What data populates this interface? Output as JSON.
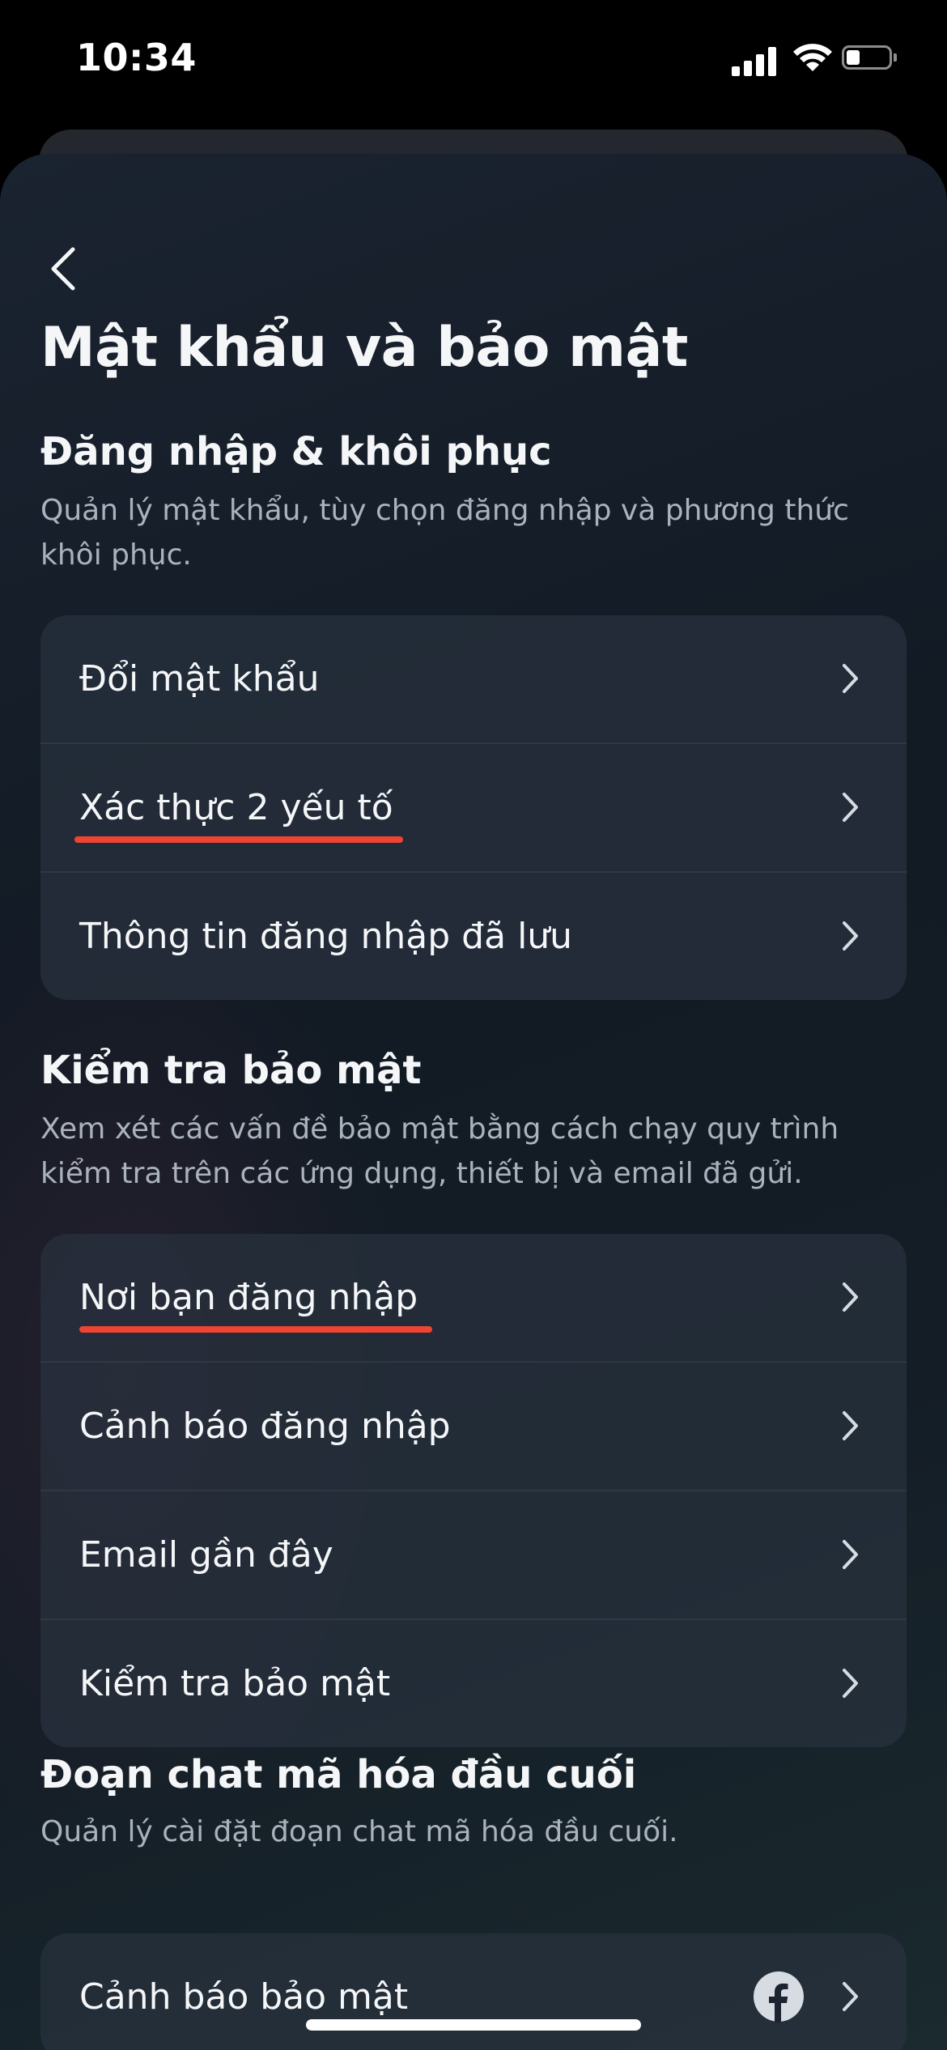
{
  "status_bar": {
    "time": "10:34"
  },
  "page": {
    "title": "Mật khẩu và bảo mật"
  },
  "sections": [
    {
      "title": "Đăng nhập & khôi phục",
      "description": "Quản lý mật khẩu, tùy chọn đăng nhập và phương thức khôi phục.",
      "items": [
        {
          "label": "Đổi mật khẩu"
        },
        {
          "label": "Xác thực 2 yếu tố"
        },
        {
          "label": "Thông tin đăng nhập đã lưu"
        }
      ]
    },
    {
      "title": "Kiểm tra bảo mật",
      "description": "Xem xét các vấn đề bảo mật bằng cách chạy quy trình kiểm tra trên các ứng dụng, thiết bị và email đã gửi.",
      "items": [
        {
          "label": "Nơi bạn đăng nhập"
        },
        {
          "label": "Cảnh báo đăng nhập"
        },
        {
          "label": "Email gần đây"
        },
        {
          "label": "Kiểm tra bảo mật"
        }
      ]
    },
    {
      "title": "Đoạn chat mã hóa đầu cuối",
      "description": "Quản lý cài đặt đoạn chat mã hóa đầu cuối.",
      "items": [
        {
          "label": "Cảnh báo bảo mật",
          "icon": "facebook-icon"
        }
      ]
    }
  ],
  "annotation_color": "#ef4433"
}
